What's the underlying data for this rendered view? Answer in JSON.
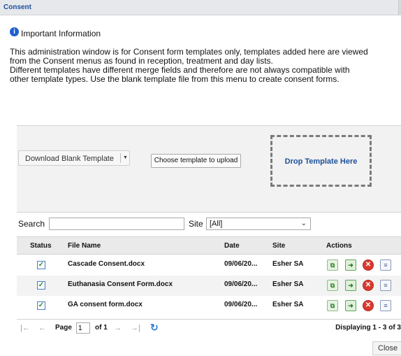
{
  "window": {
    "title": "Consent"
  },
  "info": {
    "icon": "info-icon",
    "heading": "Important Information",
    "lines": [
      "This administration window is for Consent form templates only, templates added here are viewed",
      "from the Consent menus as found in reception, treatment and day lists.",
      "Different templates have different merge fields and therefore are not always compatible with",
      "other template types. Use the blank template file from this menu to create consent forms."
    ]
  },
  "upload": {
    "download_label": "Download Blank Template",
    "dropdown_icon": "caret-down-icon",
    "choose_label": "Choose template to upload",
    "drop_label": "Drop Template Here"
  },
  "filters": {
    "search_label": "Search",
    "search_value": "",
    "site_label": "Site",
    "site_value": "[All]"
  },
  "grid": {
    "columns": [
      "Status",
      "File Name",
      "Date",
      "Site",
      "Actions"
    ],
    "rows": [
      {
        "checked": "✓",
        "file": "Cascade Consent.docx",
        "date": "09/06/20...",
        "site": "Esher SA"
      },
      {
        "checked": "✓",
        "file": "Euthanasia Consent Form.docx",
        "date": "09/06/20...",
        "site": "Esher SA"
      },
      {
        "checked": "✓",
        "file": "GA consent form.docx",
        "date": "09/06/20...",
        "site": "Esher SA"
      }
    ],
    "action_icons": [
      "copy-icon",
      "export-icon",
      "delete-icon",
      "view-icon"
    ],
    "action_glyphs": [
      "⧉",
      "➜",
      "✕",
      "≡"
    ]
  },
  "pager": {
    "first": "|←",
    "prev": "←",
    "page_label": "Page",
    "page_value": "1",
    "of_label": "of 1",
    "next": "→",
    "last": "→|",
    "refresh": "↻",
    "display_text": "Displaying 1 - 3 of 3"
  },
  "footer": {
    "close_label": "Close"
  }
}
